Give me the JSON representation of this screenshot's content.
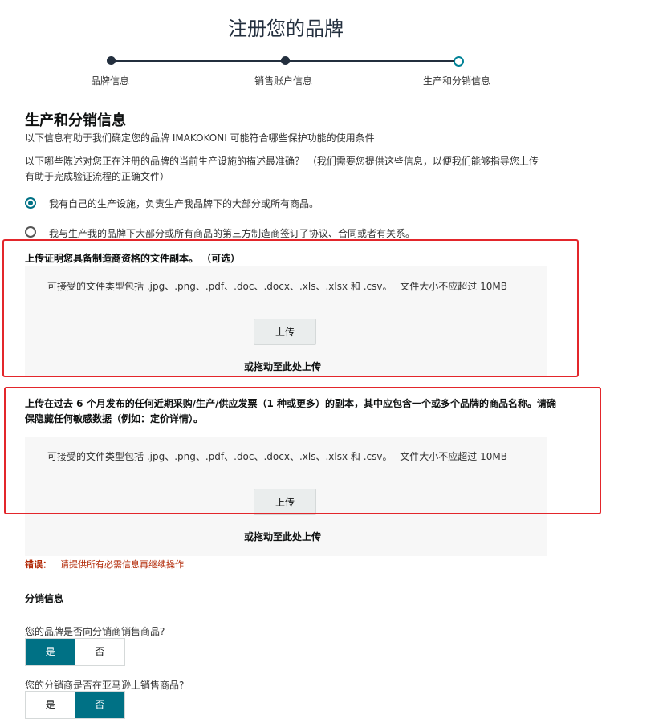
{
  "page_title": "注册您的品牌",
  "steps": [
    "品牌信息",
    "销售账户信息",
    "生产和分销信息"
  ],
  "section": {
    "title": "生产和分销信息",
    "subtitle": "以下信息有助于我们确定您的品牌 IMAKOKONI 可能符合哪些保护功能的使用条件",
    "question": "以下哪些陈述对您正在注册的品牌的当前生产设施的描述最准确？ （我们需要您提供这些信息，以便我们能够指导您上传有助于完成验证流程的正确文件）"
  },
  "options": [
    "我有自己的生产设施，负责生产我品牌下的大部分或所有商品。",
    "我与生产我的品牌下大部分或所有商品的第三方制造商签订了协议、合同或者有关系。"
  ],
  "upload1": {
    "title": "上传证明您具备制造商资格的文件副本。 （可选）",
    "hint": "可接受的文件类型包括 .jpg、.png、.pdf、.doc、.docx、.xls、.xlsx 和 .csv。　 文件大小不应超过 10MB",
    "button": "上传",
    "drop": "或拖动至此处上传"
  },
  "upload2": {
    "title": "上传在过去 6 个月发布的任何近期采购/生产/供应发票（1 种或更多）的副本，其中应包含一个或多个品牌的商品名称。请确保隐藏任何敏感数据（例如：定价详情）。",
    "hint": "可接受的文件类型包括 .jpg、.png、.pdf、.doc、.docx、.xls、.xlsx 和 .csv。　 文件大小不应超过 10MB",
    "button": "上传",
    "drop": "或拖动至此处上传"
  },
  "error": {
    "label": "错误：",
    "message": "请提供所有必需信息再继续操作"
  },
  "distribution": {
    "title": "分销信息",
    "q1": "您的品牌是否向分销商销售商品?",
    "q2": "您的分销商是否在亚马逊上销售商品?",
    "yes": "是",
    "no": "否",
    "q1_selected": "是",
    "q2_selected": "否"
  },
  "colors": {
    "accent": "#007185",
    "error": "#b12704",
    "highlight": "#e3262b"
  }
}
